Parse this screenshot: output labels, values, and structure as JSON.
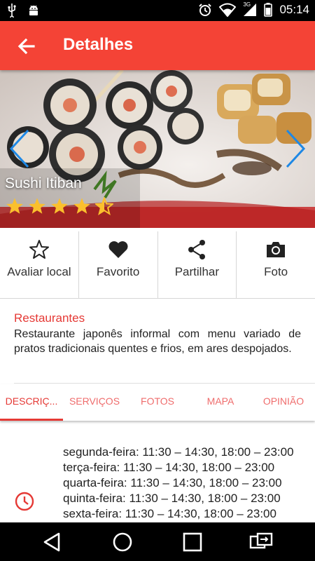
{
  "status_bar": {
    "time": "05:14",
    "network": "3G",
    "icons": [
      "usb-icon",
      "android-icon",
      "alarm-icon",
      "wifi-icon",
      "signal-icon",
      "battery-icon"
    ]
  },
  "app_bar": {
    "title": "Detalhes",
    "back_icon": "arrow-back-icon"
  },
  "hero": {
    "name": "Sushi Itiban",
    "rating": 4.5,
    "rating_max": 5
  },
  "actions": [
    {
      "label": "Avaliar local",
      "icon": "star-outline-icon"
    },
    {
      "label": "Favorito",
      "icon": "heart-icon"
    },
    {
      "label": "Partilhar",
      "icon": "share-icon"
    },
    {
      "label": "Foto",
      "icon": "camera-icon"
    }
  ],
  "description": {
    "category": "Restaurantes",
    "text": "Restaurante japonês informal com menu variado de pratos tradicionais quentes e frios, em ares despojados."
  },
  "tabs": [
    {
      "label": "DESCRIÇ...",
      "active": true
    },
    {
      "label": "SERVIÇOS",
      "active": false
    },
    {
      "label": "FOTOS",
      "active": false
    },
    {
      "label": "MAPA",
      "active": false
    },
    {
      "label": "OPINIÃO",
      "active": false
    }
  ],
  "hours": [
    "segunda-feira: 11:30 – 14:30, 18:00 – 23:00",
    "terça-feira: 11:30 – 14:30, 18:00 – 23:00",
    "quarta-feira: 11:30 – 14:30, 18:00 – 23:00",
    "quinta-feira: 11:30 – 14:30, 18:00 – 23:00",
    "sexta-feira: 11:30 – 14:30, 18:00 – 23:00"
  ],
  "colors": {
    "primary": "#f44336",
    "accent_text": "#e53935",
    "tab_inactive": "#ef6c6c",
    "star": "#fbc02d",
    "nav_arrow": "#1e88e5"
  }
}
